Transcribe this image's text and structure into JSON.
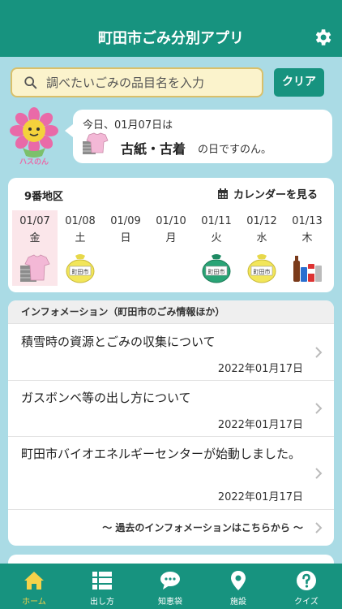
{
  "header": {
    "title": "町田市ごみ分別アプリ",
    "settings_icon": "gear-icon"
  },
  "search": {
    "placeholder": "調べたいごみの品目名を入力",
    "clear_label": "クリア"
  },
  "today_bubble": {
    "line1": "今日、01月07日は",
    "category": "古紙・古着",
    "suffix": "の日ですのん。",
    "mascot_text": "ハスのん"
  },
  "calendar": {
    "district": "9番地区",
    "link_label": "カレンダーを見る",
    "days": [
      {
        "date": "01/07",
        "weekday": "金",
        "icon": "paper-clothes-icon",
        "today": true
      },
      {
        "date": "01/08",
        "weekday": "土",
        "icon": "yellow-bag-icon",
        "bag_text": "町田市"
      },
      {
        "date": "01/09",
        "weekday": "日",
        "icon": ""
      },
      {
        "date": "01/10",
        "weekday": "月",
        "icon": ""
      },
      {
        "date": "01/11",
        "weekday": "火",
        "icon": "green-bag-icon",
        "bag_text": "町田市"
      },
      {
        "date": "01/12",
        "weekday": "水",
        "icon": "yellow-bag-icon",
        "bag_text": "町田市"
      },
      {
        "date": "01/13",
        "weekday": "木",
        "icon": "bottles-cans-icon"
      }
    ]
  },
  "info": {
    "header": "インフォメーション（町田市のごみ情報ほか）",
    "items": [
      {
        "title": "積雪時の資源とごみの収集について",
        "date": "2022年01月17日"
      },
      {
        "title": "ガスボンベ等の出し方について",
        "date": "2022年01月17日"
      },
      {
        "title": "町田市バイオエネルギーセンターが始動しました。",
        "date": "2022年01月17日"
      }
    ],
    "more_label": "〜 過去のインフォメーションはこちらから 〜"
  },
  "tabs": [
    {
      "label": "ホーム",
      "icon": "home-icon",
      "active": true
    },
    {
      "label": "出し方",
      "icon": "grid-list-icon"
    },
    {
      "label": "知恵袋",
      "icon": "chat-bubble-icon"
    },
    {
      "label": "施設",
      "icon": "location-pin-icon"
    },
    {
      "label": "クイズ",
      "icon": "question-icon"
    }
  ],
  "colors": {
    "primary": "#17937f",
    "background": "#aadbe5",
    "search_bg": "#fbf3cc",
    "today_highlight": "#fbe6ea",
    "active_tab": "#f5d24a"
  }
}
